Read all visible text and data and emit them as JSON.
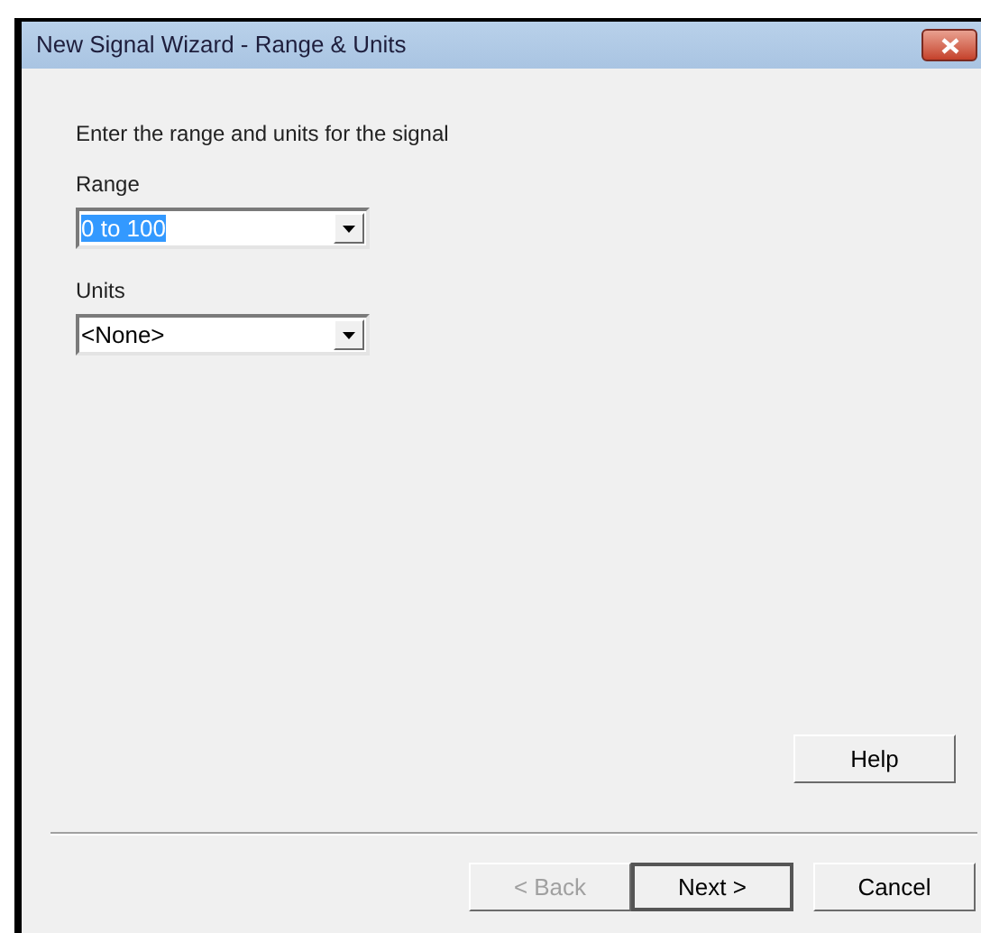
{
  "window": {
    "title": "New Signal Wizard - Range & Units"
  },
  "instruction": "Enter the range and units for the signal",
  "fields": [
    {
      "label": "Range",
      "value": "0 to 100",
      "highlighted": true
    },
    {
      "label": "Units",
      "value": "<None>",
      "highlighted": false
    }
  ],
  "help_button": {
    "label": "Help",
    "disabled": false,
    "default": false
  },
  "buttons": [
    {
      "label": "< Back",
      "disabled": true,
      "default": false
    },
    {
      "label": "Next >",
      "disabled": false,
      "default": true
    },
    {
      "label": "Cancel",
      "disabled": false,
      "default": false
    }
  ]
}
